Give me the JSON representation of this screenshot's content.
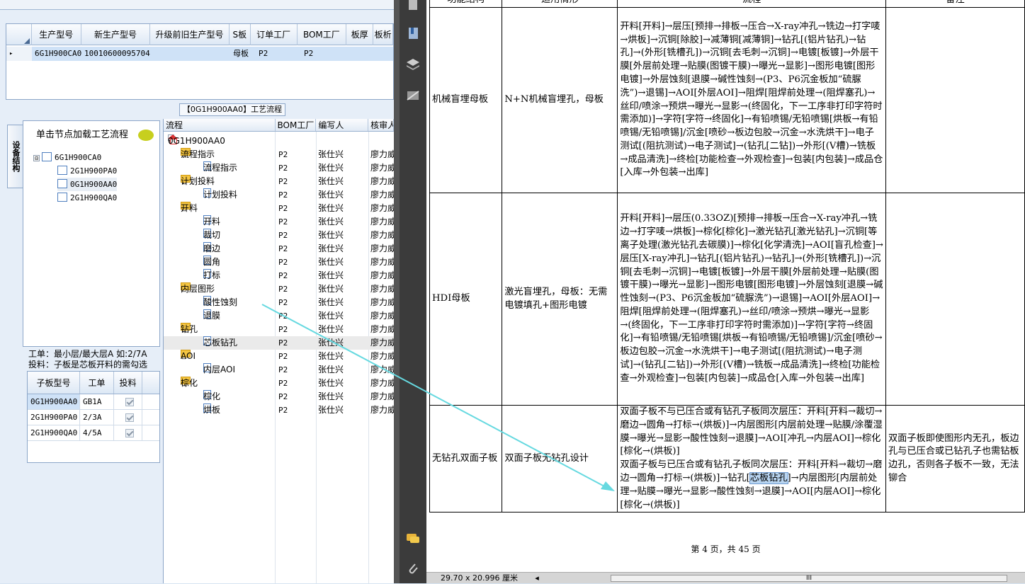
{
  "top_grid": {
    "headers": [
      "生产型号",
      "新生产型号",
      "升级前旧生产型号",
      "S板",
      "订单工厂",
      "BOM工厂",
      "板厚",
      "板析"
    ],
    "row": {
      "model": "6G1H900CA0",
      "new_model": "10010600095704",
      "old_model": "",
      "s_board": "母板",
      "order_factory": "P2",
      "bom_factory": "P2"
    }
  },
  "middle_title": "【0G1H900AA0】工艺流程",
  "side_tab_label": "设备结构",
  "node_panel": {
    "header": "单击节点加载工艺流程",
    "tree": [
      {
        "pm": "⊟",
        "label": "6G1H900CA0"
      },
      {
        "label": "2G1H900PA0"
      },
      {
        "label": "0G1H900AA0"
      },
      {
        "label": "2G1H900QA0"
      }
    ]
  },
  "info": {
    "line1": "工单：最小层/最大层A 如:2/7A",
    "line2": "投料：子板是芯板开料的需勾选"
  },
  "sub_grid": {
    "headers": [
      "子板型号",
      "工单",
      "投料"
    ],
    "rows": [
      {
        "model": "0G1H900AA0",
        "order": "GB1A"
      },
      {
        "model": "2G1H900PA0",
        "order": "2/3A"
      },
      {
        "model": "2G1H900QA0",
        "order": "4/5A"
      }
    ]
  },
  "flow_grid": {
    "headers": [
      "流程",
      "BOM工厂",
      "编写人",
      "核审人"
    ],
    "rows": [
      {
        "pm": "⊟",
        "icon": "home",
        "name": "0G1H900AA0",
        "factory": "",
        "writer": "",
        "reviewer": "",
        "indent": 0
      },
      {
        "pm": "⊟",
        "icon": "folder",
        "name": "流程指示",
        "factory": "P2",
        "writer": "张仕兴",
        "reviewer": "廖力威",
        "indent": 1
      },
      {
        "icon": "page",
        "name": "流程指示",
        "factory": "P2",
        "writer": "张仕兴",
        "reviewer": "廖力威",
        "indent": 2
      },
      {
        "pm": "⊟",
        "icon": "folder",
        "name": "计划投料",
        "factory": "P2",
        "writer": "张仕兴",
        "reviewer": "廖力威",
        "indent": 1
      },
      {
        "icon": "page",
        "name": "计划投料",
        "factory": "P2",
        "writer": "张仕兴",
        "reviewer": "廖力威",
        "indent": 2
      },
      {
        "pm": "⊟",
        "icon": "folder",
        "name": "开料",
        "factory": "P2",
        "writer": "张仕兴",
        "reviewer": "廖力威",
        "indent": 1
      },
      {
        "icon": "page",
        "name": "开料",
        "factory": "P2",
        "writer": "张仕兴",
        "reviewer": "廖力威",
        "indent": 2
      },
      {
        "icon": "page",
        "name": "裁切",
        "factory": "P2",
        "writer": "张仕兴",
        "reviewer": "廖力威",
        "indent": 2
      },
      {
        "icon": "page",
        "name": "磨边",
        "factory": "P2",
        "writer": "张仕兴",
        "reviewer": "廖力威",
        "indent": 2
      },
      {
        "icon": "page",
        "name": "圆角",
        "factory": "P2",
        "writer": "张仕兴",
        "reviewer": "廖力威",
        "indent": 2
      },
      {
        "icon": "page",
        "name": "打标",
        "factory": "P2",
        "writer": "张仕兴",
        "reviewer": "廖力威",
        "indent": 2
      },
      {
        "pm": "⊟",
        "icon": "folder",
        "name": "内层图形",
        "factory": "P2",
        "writer": "张仕兴",
        "reviewer": "廖力威",
        "indent": 1
      },
      {
        "icon": "page",
        "name": "酸性蚀刻",
        "factory": "P2",
        "writer": "张仕兴",
        "reviewer": "廖力威",
        "indent": 2
      },
      {
        "icon": "page",
        "name": "退膜",
        "factory": "P2",
        "writer": "张仕兴",
        "reviewer": "廖力威",
        "indent": 2
      },
      {
        "pm": "⊟",
        "icon": "folder",
        "name": "钻孔",
        "factory": "P2",
        "writer": "张仕兴",
        "reviewer": "廖力威",
        "indent": 1
      },
      {
        "icon": "page",
        "name": "芯板钻孔",
        "factory": "P2",
        "writer": "张仕兴",
        "reviewer": "廖力威",
        "indent": 2,
        "selected": true
      },
      {
        "pm": "⊟",
        "icon": "folder",
        "name": "AOI",
        "factory": "P2",
        "writer": "张仕兴",
        "reviewer": "廖力威",
        "indent": 1
      },
      {
        "icon": "page",
        "name": "内层AOI",
        "factory": "P2",
        "writer": "张仕兴",
        "reviewer": "廖力威",
        "indent": 2
      },
      {
        "pm": "⊟",
        "icon": "folder",
        "name": "棕化",
        "factory": "P2",
        "writer": "张仕兴",
        "reviewer": "廖力威",
        "indent": 1
      },
      {
        "icon": "page",
        "name": "棕化",
        "factory": "P2",
        "writer": "张仕兴",
        "reviewer": "廖力威",
        "indent": 2
      },
      {
        "icon": "page",
        "name": "烘板",
        "factory": "P2",
        "writer": "张仕兴",
        "reviewer": "廖力威",
        "indent": 2
      }
    ]
  },
  "pdf": {
    "table_headers": [
      "功能结构",
      "适用情形",
      "流程",
      "备注"
    ],
    "rows": [
      {
        "func": "机械盲埋母板",
        "case": "N+N机械盲埋孔，母板",
        "flow": "开料[开料]→层压[预排→排板→压合→X-ray冲孔→铣边→打字唛→烘板]→沉铜[除胶]→减薄铜[减薄铜]→钻孔[(铝片钻孔)→钻孔]→(外形[铣槽孔])→沉铜[去毛刺→沉铜]→电镀[板镀]→外层干膜[外层前处理→贴膜(图镀干膜)→曝光→显影]→图形电镀[图形电镀]→外层蚀刻[退膜→碱性蚀刻→(P3、P6沉金板加“硫脲洗”)→退锡]→AOI[外层AOI]→阻焊[阻焊前处理→(阻焊塞孔)→丝印/喷涂→预烘→曝光→显影→(终固化，下一工序非打印字符时需添加)]→字符[字符→终固化]→有铅喷锡/无铅喷锡[烘板→有铅喷锡/无铅喷锡]/沉金[喷砂→板边包胶→沉金→水洗烘干]→电子测试[(阻抗测试)→电子测试]→(钻孔[二钻])→外形[(V槽)→铣板→成品清洗]→终检[功能检查→外观检查]→包装[内包装]→成品仓[入库→外包装→出库]",
        "note": ""
      },
      {
        "func": "HDI母板",
        "case": "激光盲埋孔，母板：无需电镀填孔+图形电镀",
        "flow": "开料[开料]→层压(0.33OZ)[预排→排板→压合→X-ray冲孔→铣边→打字唛→烘板]→棕化[棕化]→激光钻孔[激光钻孔]→沉铜[等离子处理(激光钻孔去碳膜)]→棕化[化学清洗]→AOI[盲孔检查]→层压[X-ray冲孔]→钻孔[(铝片钻孔)→钻孔]→(外形[铣槽孔])→沉铜[去毛刺→沉铜]→电镀[板镀]→外层干膜[外层前处理→贴膜(图镀干膜)→曝光→显影]→图形电镀[图形电镀]→外层蚀刻[退膜→碱性蚀刻→(P3、P6沉金板加“硫脲洗”)→退锡]→AOI[外层AOI]→阻焊[阻焊前处理→(阻焊塞孔)→丝印/喷涂→预烘→曝光→显影→(终固化，下一工序非打印字符时需添加)]→字符[字符→终固化]→有铅喷锡/无铅喷锡[烘板→有铅喷锡/无铅喷锡]/沉金[喷砂→板边包胶→沉金→水洗烘干]→电子测试[(阻抗测试)→电子测试]→(钻孔[二钻])→外形[(V槽)→铣板→成品清洗]→终检[功能检查→外观检查]→包装[内包装]→成品仓[入库→外包装→出库]",
        "note": ""
      },
      {
        "func": "无钻孔双面子板",
        "case": "双面子板无钻孔设计",
        "flow_a": "双面子板不与已压合或有钻孔子板同次层压：开料[开料→裁切→磨边→圆角→打标→(烘板)]→内层图形[内层前处理→贴膜/涂覆湿膜→曝光→显影→酸性蚀刻→退膜]→AOI[冲孔→内层AOI]→棕化[棕化→(烘板)]",
        "flow_b_pre": "双面子板与已压合或有钻孔子板同次层压：开料[开料→裁切→磨边→圆角→打标→(烘板)]→钻孔[",
        "flow_b_hl": "芯板钻孔",
        "flow_b_post": "]→内层图形[内层前处理→贴膜→曝光→显影→酸性蚀刻→退膜]→AOI[内层AOI]→棕化[棕化→(烘板)]",
        "note": "双面子板即使图形内无孔，板边孔与已压合或已钻孔子也需钻板边孔，否则各子板不一致，无法铆合"
      }
    ],
    "footer": "第 4 页，共 45 页",
    "status_size": "29.70 x 20.996 厘米",
    "scroll_mark": "III"
  },
  "colors": {
    "arrow": "#66d9e0",
    "selection": "#cfe2f7",
    "highlight": "#b8d4f0"
  }
}
